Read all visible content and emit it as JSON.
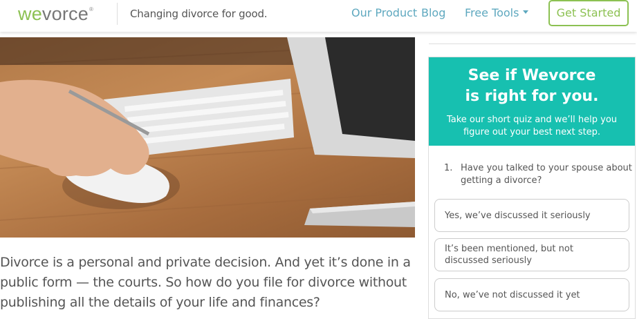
{
  "header": {
    "logo_we": "we",
    "logo_vorce": "vorce",
    "logo_mark": "®",
    "tagline": "Changing divorce for good.",
    "nav": {
      "product": "Our Product",
      "blog": "Blog",
      "tools": "Free Tools"
    },
    "cta": "Get Started"
  },
  "article": {
    "lead": "Divorce is a personal and private decision. And yet it’s done in a public form — the courts. So how do you file for divorce without publishing all the details of your life and finances?"
  },
  "quiz": {
    "title_line1": "See if Wevorce",
    "title_line2": "is right for you.",
    "subtitle": "Take our short quiz and we’ll help you figure out your best next step.",
    "question_number": "1.",
    "question_text": "Have you talked to your spouse about getting a divorce?",
    "answers": [
      "Yes, we’ve discussed it seriously",
      "It’s been mentioned, but not discussed seriously",
      "No, we’ve not discussed it yet"
    ]
  },
  "colors": {
    "brand_green": "#8cc152",
    "nav_blue": "#5ea8bf",
    "quiz_teal": "#17c0b0"
  },
  "icons": {
    "dropdown": "caret-down-icon"
  }
}
